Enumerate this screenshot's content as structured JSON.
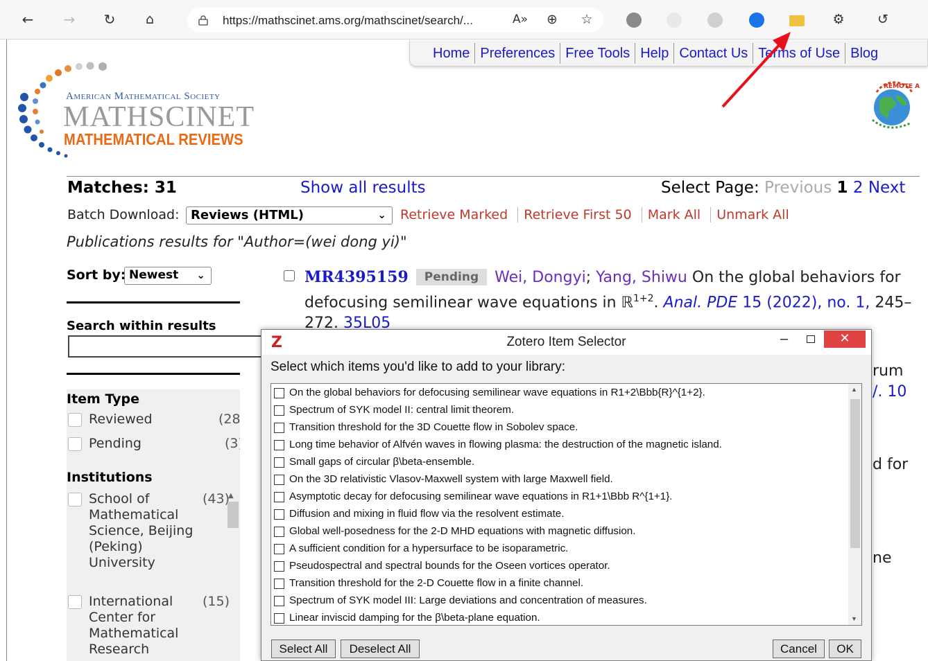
{
  "browser": {
    "url": "https://mathscinet.ams.org/mathscinet/search/...",
    "read_aloud_label": "A»"
  },
  "nav": {
    "items": [
      "Home",
      "Preferences",
      "Free Tools",
      "Help",
      "Contact Us",
      "Terms of Use",
      "Blog"
    ]
  },
  "logo": {
    "org": "American Mathematical Society",
    "product": "MATHSCINET",
    "subtitle": "MATHEMATICAL REVIEWS",
    "remote": "REMOTE ACCESS"
  },
  "results": {
    "matches_label": "Matches: 31",
    "show_all": "Show all results",
    "select_page": "Select Page:",
    "previous": "Previous",
    "page1": "1",
    "page2": "2",
    "next": "Next",
    "batch_label": "Batch Download:",
    "batch_value": "Reviews (HTML)",
    "batch_links": [
      "Retrieve Marked",
      "Retrieve First 50",
      "Mark All",
      "Unmark All"
    ],
    "query": "Publications results for \"Author=(wei dong yi)\""
  },
  "sidebar": {
    "sort_label": "Sort by:",
    "sort_value": "Newest",
    "search_within": "Search within results",
    "item_type_title": "Item Type",
    "item_types": [
      {
        "label": "Reviewed",
        "count": "(28)"
      },
      {
        "label": "Pending",
        "count": "(3)"
      }
    ],
    "institutions_title": "Institutions",
    "institutions": [
      {
        "label": "School of Mathematical Science, Beijing (Peking) University",
        "count": "(43)"
      },
      {
        "label": "International Center for Mathematical Research",
        "count": "(15)"
      }
    ]
  },
  "first_result": {
    "mr": "MR4395159",
    "badge": "Pending",
    "author1": "Wei, Dongyi",
    "sep": ";",
    "author2": "Yang, Shiwu",
    "title_a": "On the global behaviors for defocusing semilinear wave equations in ℝ",
    "title_sup": "1+2",
    "title_b": ".",
    "journal": "Anal. PDE",
    "volume": "15 (2022), no. 1,",
    "pages": "245–272.",
    "msc": "35L05"
  },
  "peeks": {
    "p1": "rum",
    "p2": "/. 10",
    "p3": "d for",
    "p4": "ne"
  },
  "zotero": {
    "logo": "Z",
    "title": "Zotero Item Selector",
    "instructions": "Select which items you'd like to add to your library:",
    "items": [
      "On the global behaviors for defocusing semilinear wave equations in R1+2\\Bbb{R}^{1+2}.",
      "Spectrum of SYK model II: central limit theorem.",
      "Transition threshold for the 3D Couette flow in Sobolev space.",
      "Long time behavior of Alfvén waves in flowing plasma: the destruction of the magnetic island.",
      "Small gaps of circular β\\beta-ensemble.",
      "On the 3D relativistic Vlasov-Maxwell system with large Maxwell field.",
      "Asymptotic decay for defocusing semilinear wave equations in R1+1\\Bbb R^{1+1}.",
      "Diffusion and mixing in fluid flow via the resolvent estimate.",
      "Global well-posedness for the 2-D MHD equations with magnetic diffusion.",
      "A sufficient condition for a hypersurface to be isoparametric.",
      "Pseudospectral and spectral bounds for the Oseen vortices operator.",
      "Transition threshold for the 2-D Couette flow in a finite channel.",
      "Spectrum of SYK model III: Large deviations and concentration of measures.",
      "Linear inviscid damping for the β\\beta-plane equation."
    ],
    "select_all": "Select All",
    "deselect_all": "Deselect All",
    "cancel": "Cancel",
    "ok": "OK"
  },
  "colors": {
    "link": "#1a1ac8",
    "batch_link": "#c0392b",
    "author": "#6a2dbf",
    "mr_orange": "#e86a14",
    "close_red": "#e04343",
    "annotation_arrow": "#e8101a"
  }
}
